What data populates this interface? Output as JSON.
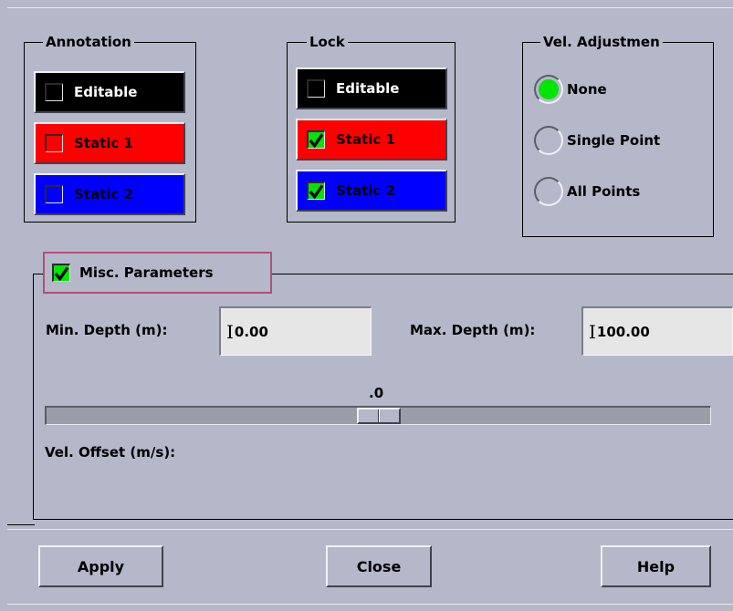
{
  "annotation": {
    "title": "Annotation",
    "options": [
      {
        "label": "Editable",
        "checked": false,
        "color": "#000000",
        "text_color": "#ffffff"
      },
      {
        "label": "Static 1",
        "checked": false,
        "color": "#ff0000",
        "text_color": "#000000"
      },
      {
        "label": "Static 2",
        "checked": false,
        "color": "#0000ff",
        "text_color": "#000000"
      }
    ]
  },
  "lock": {
    "title": "Lock",
    "options": [
      {
        "label": "Editable",
        "checked": false,
        "color": "#000000",
        "text_color": "#ffffff"
      },
      {
        "label": "Static 1",
        "checked": true,
        "color": "#ff0000",
        "text_color": "#000000"
      },
      {
        "label": "Static 2",
        "checked": true,
        "color": "#0000ff",
        "text_color": "#000000"
      }
    ]
  },
  "vel_adjustment": {
    "title": "Vel. Adjustmen",
    "options": [
      {
        "label": "None",
        "selected": true
      },
      {
        "label": "Single Point",
        "selected": false
      },
      {
        "label": "All Points",
        "selected": false
      }
    ],
    "selected_color": "#00e600"
  },
  "misc": {
    "checkbox_label": "Misc. Parameters",
    "checked": true,
    "min_depth_label": "Min. Depth  (m):",
    "min_depth_value": "0.00",
    "max_depth_label": "Max. Depth (m):",
    "max_depth_value": "100.00",
    "slider_value_text": ".0",
    "slider_fraction": 0.5,
    "vel_offset_label": "Vel. Offset (m/s):"
  },
  "buttons": {
    "apply": "Apply",
    "close": "Close",
    "help": "Help"
  },
  "colors": {
    "background": "#b4b8c8",
    "check_green": "#00e600",
    "highlight_border": "#b0507a"
  }
}
